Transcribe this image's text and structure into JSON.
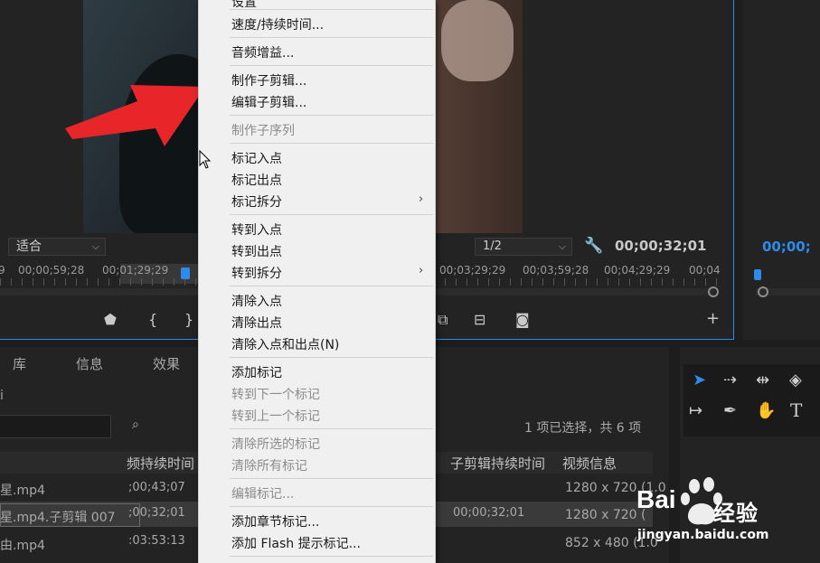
{
  "source_monitor": {
    "fit_label": "适合",
    "resolution": "1/2",
    "timecode": "00;00;32;01",
    "ruler": [
      "9",
      "00;00;59;28",
      "00;01;29;29",
      "00;03;29;29",
      "00;03;59;28",
      "00;04;29;29",
      "00;04"
    ]
  },
  "program_monitor": {
    "timecode": "00;00;"
  },
  "project_panel": {
    "tabs": [
      "库",
      "信息",
      "效果"
    ],
    "left_stub": "i",
    "selection_info": "1 项已选择，共 6 项",
    "columns": [
      "频持续时间",
      "子剪辑持续时间",
      "视频信息"
    ],
    "rows": [
      {
        "name": "星.mp4",
        "duration": ";00;43;07",
        "clip_duration": "",
        "video_info": "1280 x 720 (1.0",
        "selected": false
      },
      {
        "name": "星.mp4.子剪辑 007",
        "duration": ";00;32;01",
        "clip_duration": "00;00;32;01",
        "video_info": "1280 x 720 (",
        "selected": true
      },
      {
        "name": "由.mp4",
        "duration": ":03:53:13",
        "clip_duration": "",
        "video_info": "852 x 480 (1.0",
        "selected": false
      }
    ]
  },
  "context_menu": {
    "top_partial": "设置",
    "items": [
      {
        "label": "速度/持续时间...",
        "disabled": false
      },
      {
        "label": "音频增益...",
        "disabled": false
      },
      {
        "label": "制作子剪辑...",
        "disabled": false
      },
      {
        "label": "编辑子剪辑...",
        "disabled": false
      },
      {
        "label": "制作子序列",
        "disabled": true
      },
      {
        "label": "标记入点",
        "disabled": false
      },
      {
        "label": "标记出点",
        "disabled": false
      },
      {
        "label": "标记拆分",
        "disabled": false,
        "submenu": true
      },
      {
        "label": "转到入点",
        "disabled": false
      },
      {
        "label": "转到出点",
        "disabled": false
      },
      {
        "label": "转到拆分",
        "disabled": false,
        "submenu": true
      },
      {
        "label": "清除入点",
        "disabled": false
      },
      {
        "label": "清除出点",
        "disabled": false
      },
      {
        "label": "清除入点和出点(N)",
        "disabled": false
      },
      {
        "label": "添加标记",
        "disabled": false
      },
      {
        "label": "转到下一个标记",
        "disabled": true
      },
      {
        "label": "转到上一个标记",
        "disabled": true
      },
      {
        "label": "清除所选的标记",
        "disabled": true
      },
      {
        "label": "清除所有标记",
        "disabled": true
      },
      {
        "label": "编辑标记...",
        "disabled": true
      },
      {
        "label": "添加章节标记...",
        "disabled": false
      },
      {
        "label": "添加 Flash 提示标记...",
        "disabled": false
      }
    ],
    "submenu_glyph": "›"
  },
  "icons": {
    "wrench": "wrench-icon",
    "marker": "marker-icon",
    "mark_in": "mark-in-icon",
    "mark_out": "mark-out-icon",
    "insert": "insert-icon",
    "overwrite": "overwrite-icon",
    "export_frame": "camera-icon",
    "add": "plus-icon"
  },
  "tools": [
    "selection",
    "track-select-forward",
    "ripple-edit",
    "razor",
    "slip",
    "pen",
    "hand",
    "type"
  ],
  "watermark": {
    "brand": "Bai",
    "brand2": "经验",
    "url": "jingyan.baidu.com"
  },
  "colors": {
    "accent": "#2d8ceb",
    "arrow": "#e8262a",
    "menu_bg": "#f0f0f0"
  }
}
